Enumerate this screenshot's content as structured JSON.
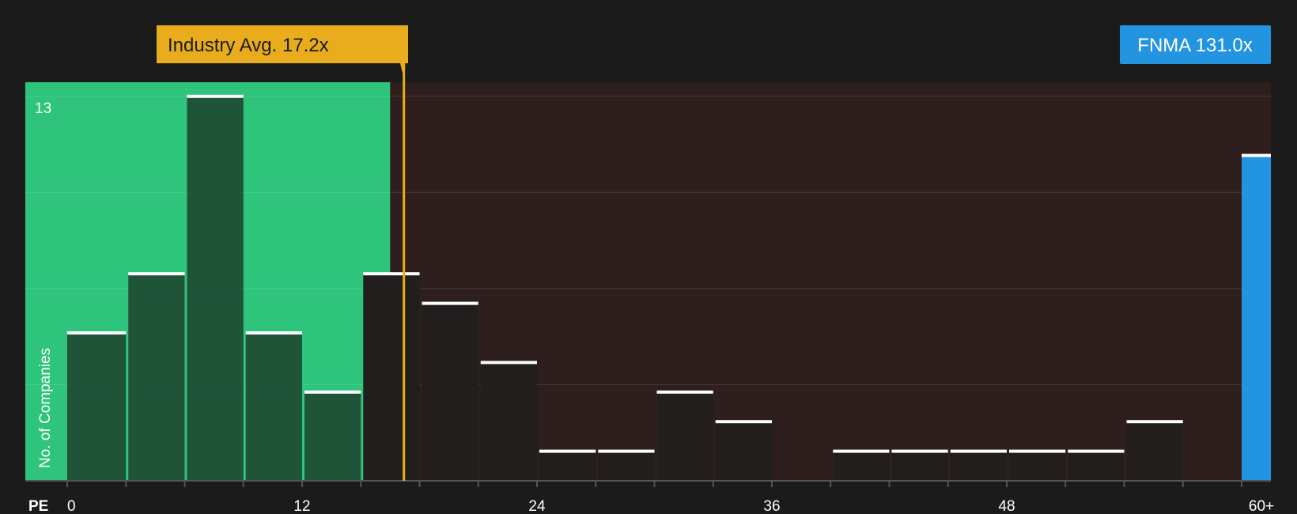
{
  "chart_data": {
    "type": "bar",
    "title": "",
    "xlabel": "PE",
    "ylabel": "No. of Companies",
    "xlim": [
      0,
      60
    ],
    "ylim": [
      0,
      13
    ],
    "y_top_tick": "13",
    "x_ticks": [
      {
        "value": 0,
        "label": "0"
      },
      {
        "value": 12,
        "label": "12"
      },
      {
        "value": 24,
        "label": "24"
      },
      {
        "value": 36,
        "label": "36"
      },
      {
        "value": 48,
        "label": "48"
      },
      {
        "value": 60,
        "label": "60+"
      }
    ],
    "bin_width": 3,
    "bins": [
      {
        "start": 0,
        "count": 5
      },
      {
        "start": 3,
        "count": 7
      },
      {
        "start": 6,
        "count": 13
      },
      {
        "start": 9,
        "count": 5
      },
      {
        "start": 12,
        "count": 3
      },
      {
        "start": 15,
        "count": 7
      },
      {
        "start": 18,
        "count": 6
      },
      {
        "start": 21,
        "count": 4
      },
      {
        "start": 24,
        "count": 1
      },
      {
        "start": 27,
        "count": 1
      },
      {
        "start": 30,
        "count": 3
      },
      {
        "start": 33,
        "count": 2
      },
      {
        "start": 36,
        "count": 0
      },
      {
        "start": 39,
        "count": 1
      },
      {
        "start": 42,
        "count": 1
      },
      {
        "start": 45,
        "count": 1
      },
      {
        "start": 48,
        "count": 1
      },
      {
        "start": 51,
        "count": 1
      },
      {
        "start": 54,
        "count": 2
      },
      {
        "start": 57,
        "count": 0
      }
    ],
    "industry_avg": {
      "label": "Industry Avg. 17.2x",
      "value": 17.2
    },
    "fair_zone_end": 16.5,
    "company": {
      "label": "FNMA 131.0x",
      "value": 131.0,
      "bar_count": 11
    },
    "grid": true,
    "colors": {
      "background": "#1b1b1b",
      "green_zone": "#2ec47c",
      "red_zone": "#2f1e1e",
      "bar_in_green": "#1f4a33",
      "bar_in_red": "#231e1e",
      "bar_cap": "#ffffff",
      "industry_line": "#e8ac1d",
      "industry_label_bg": "#e8ac1d",
      "industry_label_text": "#1b1b1b",
      "company_bar": "#2394e0",
      "company_label_bg": "#2394e0",
      "company_label_text": "#ffffff",
      "gridline": "#4a3a3a",
      "axis": "#555555",
      "text": "#ffffff"
    }
  }
}
